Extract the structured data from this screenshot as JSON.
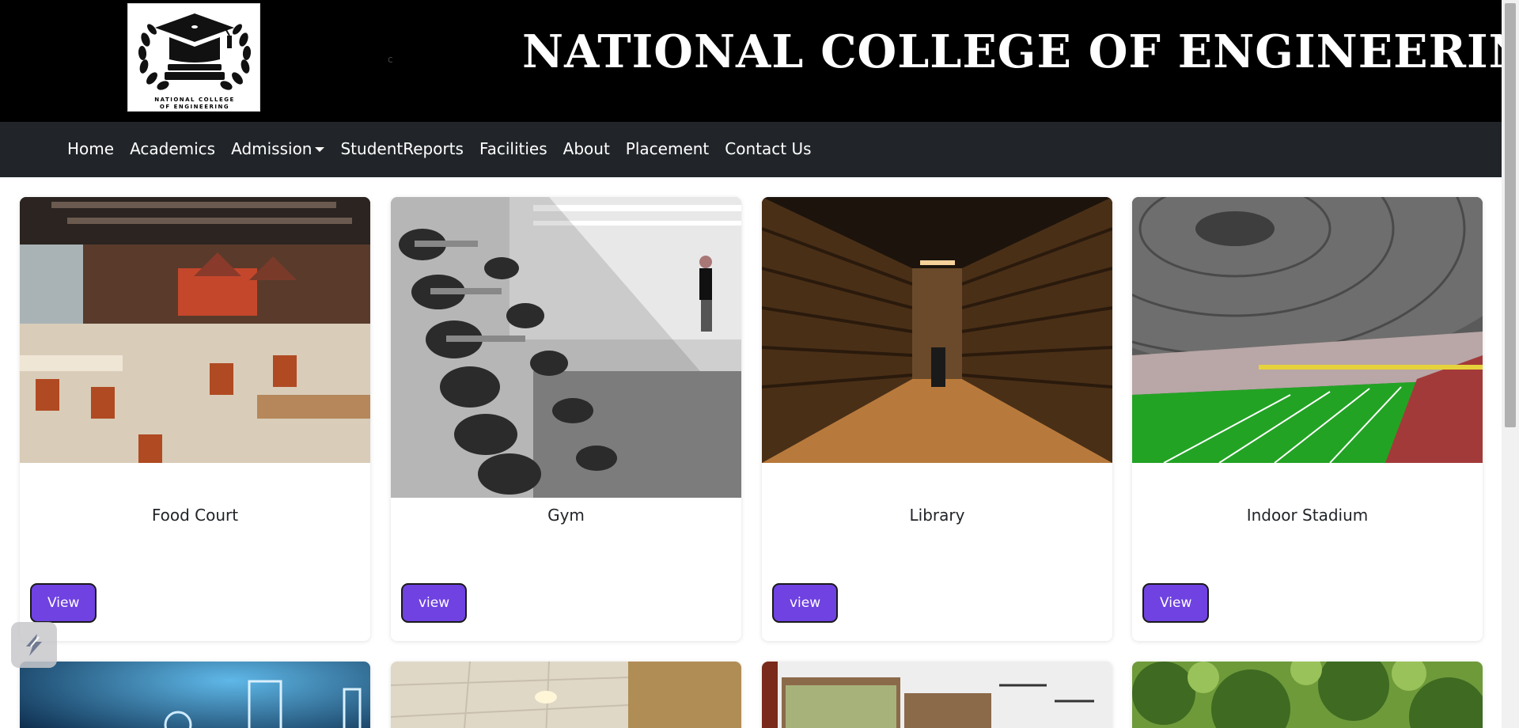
{
  "header": {
    "logo_line1": "NATIONAL COLLEGE",
    "logo_line2": "OF ENGINEERING",
    "stray_char": "c",
    "title": "NATIONAL COLLEGE OF ENGINEERING"
  },
  "nav": {
    "items": [
      {
        "label": "Home"
      },
      {
        "label": "Academics"
      },
      {
        "label": "Admission",
        "dropdown": true
      },
      {
        "label": "StudentReports"
      },
      {
        "label": "Facilities"
      },
      {
        "label": "About"
      },
      {
        "label": "Placement"
      },
      {
        "label": "Contact Us"
      }
    ]
  },
  "cards": [
    {
      "title": "Food Court",
      "button": "View",
      "image": "restaurant-interior"
    },
    {
      "title": "Gym",
      "button": "view",
      "image": "dumbbell-rack"
    },
    {
      "title": "Library",
      "button": "view",
      "image": "library-bookshelves"
    },
    {
      "title": "Indoor Stadium",
      "button": "View",
      "image": "domed-football-stadium"
    }
  ],
  "second_row_images": [
    "laboratory-glassware",
    "classroom-ceiling",
    "hall-with-windows",
    "trees-garden"
  ],
  "colors": {
    "header_bg": "#000000",
    "navbar_bg": "#212529",
    "button_bg": "#6f42e1",
    "nav_text": "#ffffff"
  },
  "icons": {
    "logo": "graduation-cap-laurel-icon",
    "floating": "streamlit-style-logo-icon"
  }
}
